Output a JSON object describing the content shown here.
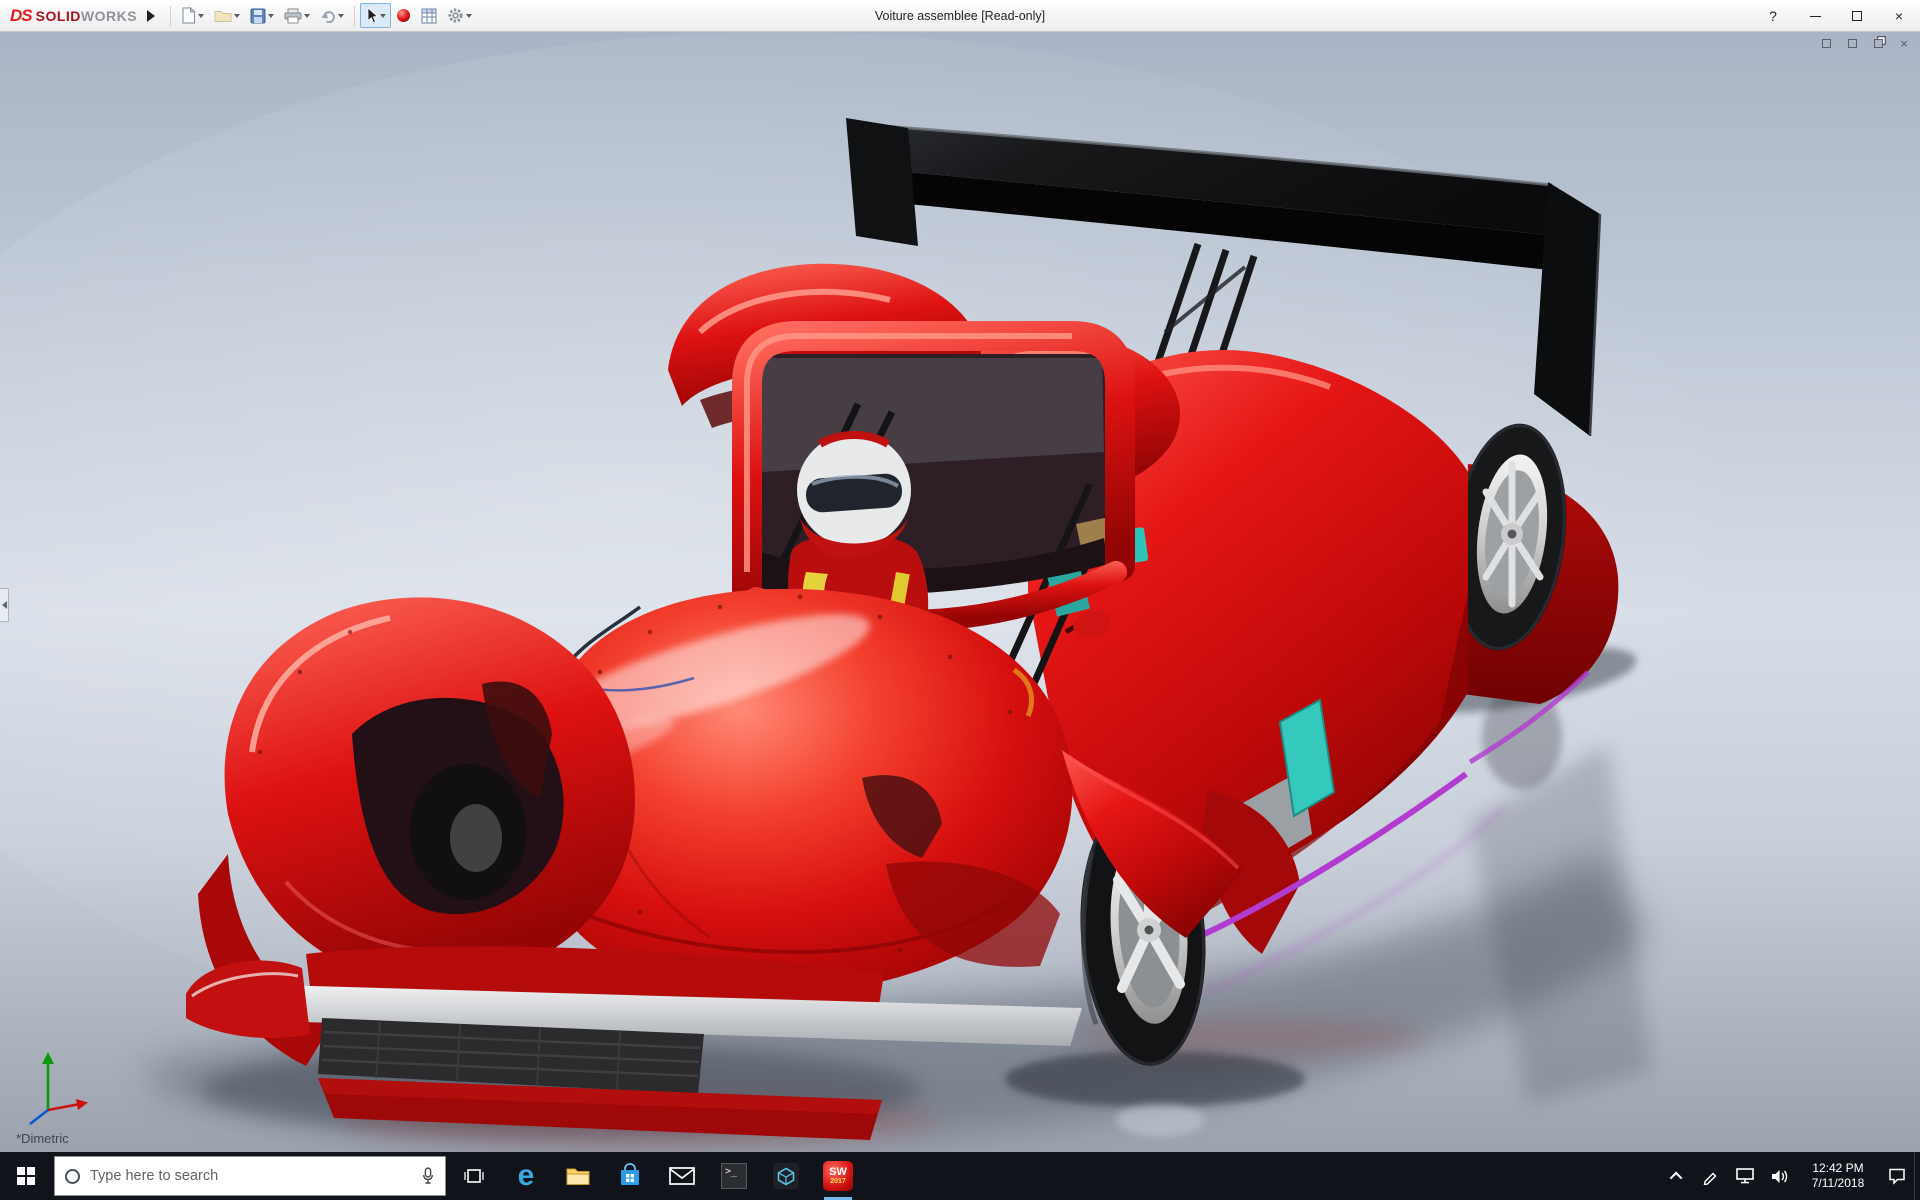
{
  "window": {
    "title": "Voiture assemblee [Read-only]",
    "help_label": "?"
  },
  "brand": {
    "logo": "DS",
    "name_bold": "SOLID",
    "name_light": "WORKS"
  },
  "toolbar": {
    "icons": [
      "new-document",
      "open-document",
      "save",
      "print",
      "undo",
      "select-cursor",
      "render-sphere",
      "design-table",
      "options-gear"
    ]
  },
  "viewport": {
    "view_label": "*Dimetric",
    "doc_window_controls": [
      "tile-left",
      "tile-right",
      "restore",
      "close"
    ]
  },
  "model": {
    "subject": "red-lemans-prototype-race-car-with-driver",
    "colors": {
      "body_red": "#d40b0b",
      "body_highlight": "#ff6a5a",
      "wing_black": "#121212",
      "accent_purple": "#b23cd0",
      "accent_teal": "#2fc4b8",
      "harness_yellow": "#e6d23e",
      "splitter_silver": "#d8dadd",
      "background_top": "#a9b5c6",
      "background_mid": "#d7dde7"
    }
  },
  "taskbar": {
    "search_placeholder": "Type here to search",
    "edge_label": "e",
    "console_label": ">_",
    "solidworks_label": "SW",
    "solidworks_year": "2017",
    "apps": [
      "start",
      "search",
      "task-view",
      "edge",
      "file-explorer",
      "store",
      "mail",
      "console",
      "model-viewer",
      "solidworks-2017"
    ],
    "tray": [
      "hidden-icons",
      "pen",
      "network",
      "volume",
      "clock",
      "action-center"
    ],
    "clock": {
      "time": "12:42 PM",
      "date": "7/11/2018"
    }
  }
}
